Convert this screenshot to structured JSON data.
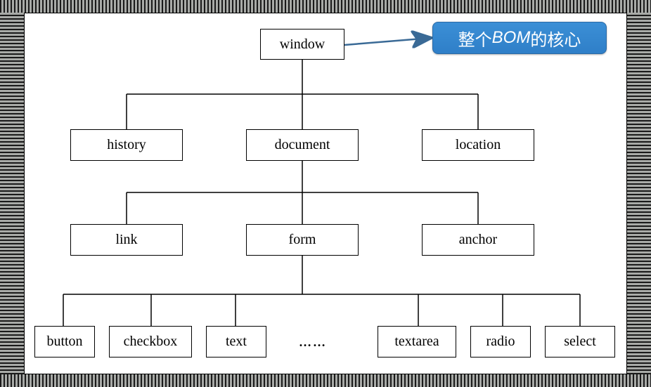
{
  "diagram": {
    "root": "window",
    "level2": {
      "left": "history",
      "mid": "document",
      "right": "location"
    },
    "level3": {
      "left": "link",
      "mid": "form",
      "right": "anchor"
    },
    "leaves": {
      "b1": "button",
      "b2": "checkbox",
      "b3": "text",
      "ellipsis": "……",
      "b4": "textarea",
      "b5": "radio",
      "b6": "select"
    }
  },
  "callout": {
    "text_prefix": "整个",
    "text_em": "BOM",
    "text_suffix": "的核心"
  }
}
